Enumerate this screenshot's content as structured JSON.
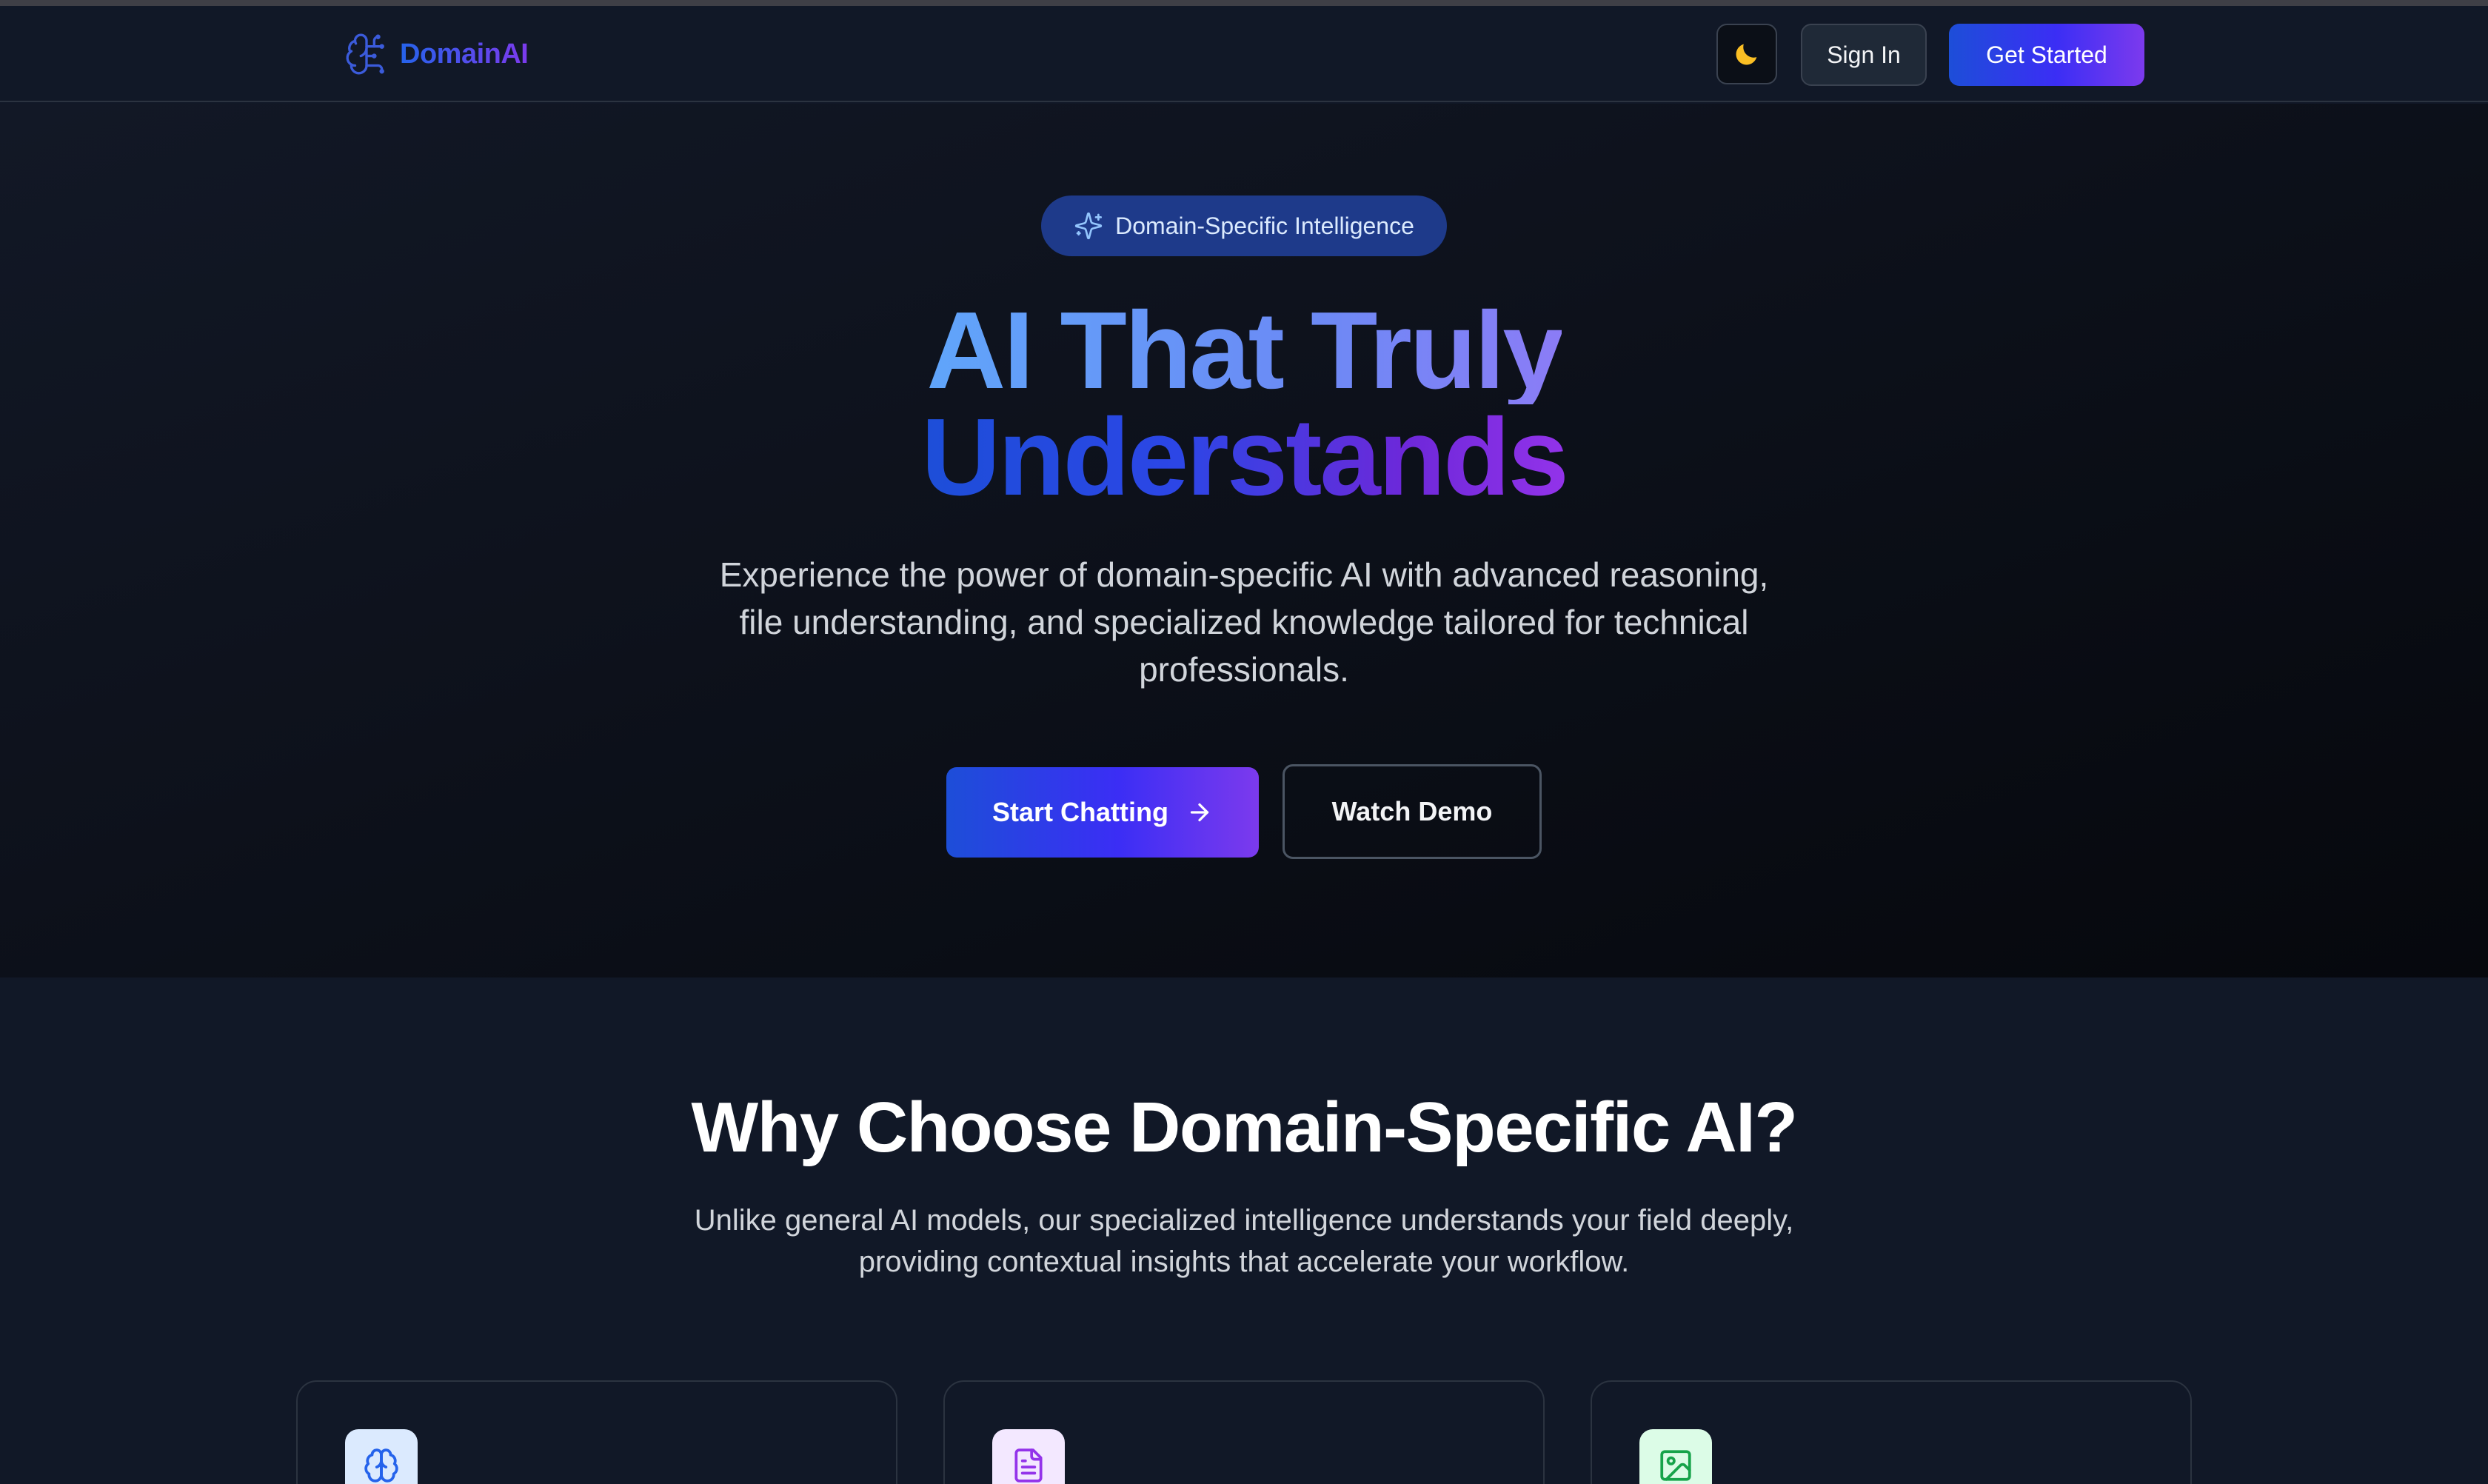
{
  "nav": {
    "brand_name": "DomainAI",
    "brand_icon": "brain-circuit-icon",
    "theme_toggle_icon": "moon-icon",
    "signin_label": "Sign In",
    "get_started_label": "Get Started"
  },
  "hero": {
    "badge_icon": "sparkles-icon",
    "badge_label": "Domain-Specific Intelligence",
    "title_line1": "AI That Truly",
    "title_line2": "Understands",
    "subtitle": "Experience the power of domain-specific AI with advanced reasoning, file understanding, and specialized knowledge tailored for technical professionals.",
    "primary_cta": "Start Chatting",
    "primary_cta_icon": "arrow-right-icon",
    "secondary_cta": "Watch Demo"
  },
  "features": {
    "title": "Why Choose Domain-Specific AI?",
    "subtitle": "Unlike general AI models, our specialized intelligence understands your field deeply, providing contextual insights that accelerate your workflow.",
    "cards": [
      {
        "icon": "brain-icon",
        "color": "#2563eb"
      },
      {
        "icon": "file-text-icon",
        "color": "#9333ea"
      },
      {
        "icon": "image-icon",
        "color": "#16a34a"
      }
    ]
  },
  "colors": {
    "accent_blue": "#1d4ed8",
    "accent_purple": "#7c3aed",
    "background": "#111827"
  }
}
